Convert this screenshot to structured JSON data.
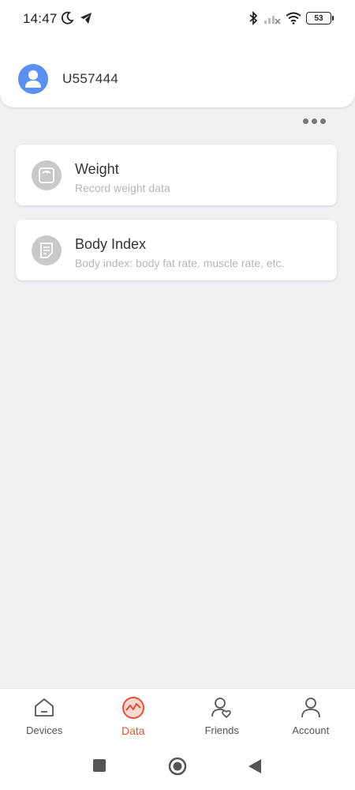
{
  "status_bar": {
    "time": "14:47",
    "battery": "53"
  },
  "user": {
    "name": "U557444"
  },
  "cards": [
    {
      "title": "Weight",
      "subtitle": "Record weight data",
      "icon": "scale-icon"
    },
    {
      "title": "Body Index",
      "subtitle": "Body index: body fat rate, muscle rate, etc.",
      "icon": "document-icon"
    }
  ],
  "tabs": [
    {
      "label": "Devices",
      "icon": "home-icon",
      "active": false
    },
    {
      "label": "Data",
      "icon": "chart-icon",
      "active": true
    },
    {
      "label": "Friends",
      "icon": "friends-icon",
      "active": false
    },
    {
      "label": "Account",
      "icon": "person-icon",
      "active": false
    }
  ],
  "colors": {
    "accent": "#e2533a",
    "avatar": "#5b8ff1",
    "background": "#f1f0f3"
  }
}
